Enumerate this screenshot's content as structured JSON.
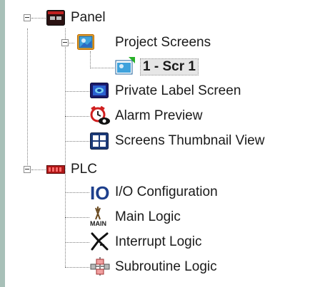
{
  "tree": {
    "panel": {
      "label": "Panel",
      "children": {
        "project_screens": {
          "label": "Project Screens",
          "children": {
            "scr1": {
              "label": "1 - Scr 1"
            }
          }
        },
        "private_label_screen": {
          "label": "Private Label Screen"
        },
        "alarm_preview": {
          "label": "Alarm Preview"
        },
        "screens_thumbnail_view": {
          "label": "Screens Thumbnail View"
        }
      }
    },
    "plc": {
      "label": "PLC",
      "children": {
        "io_configuration": {
          "label": "I/O Configuration",
          "icon_text": "IO"
        },
        "main_logic": {
          "label": "Main Logic",
          "icon_text": "MAIN"
        },
        "interrupt_logic": {
          "label": "Interrupt Logic"
        },
        "subroutine_logic": {
          "label": "Subroutine Logic"
        }
      }
    }
  }
}
